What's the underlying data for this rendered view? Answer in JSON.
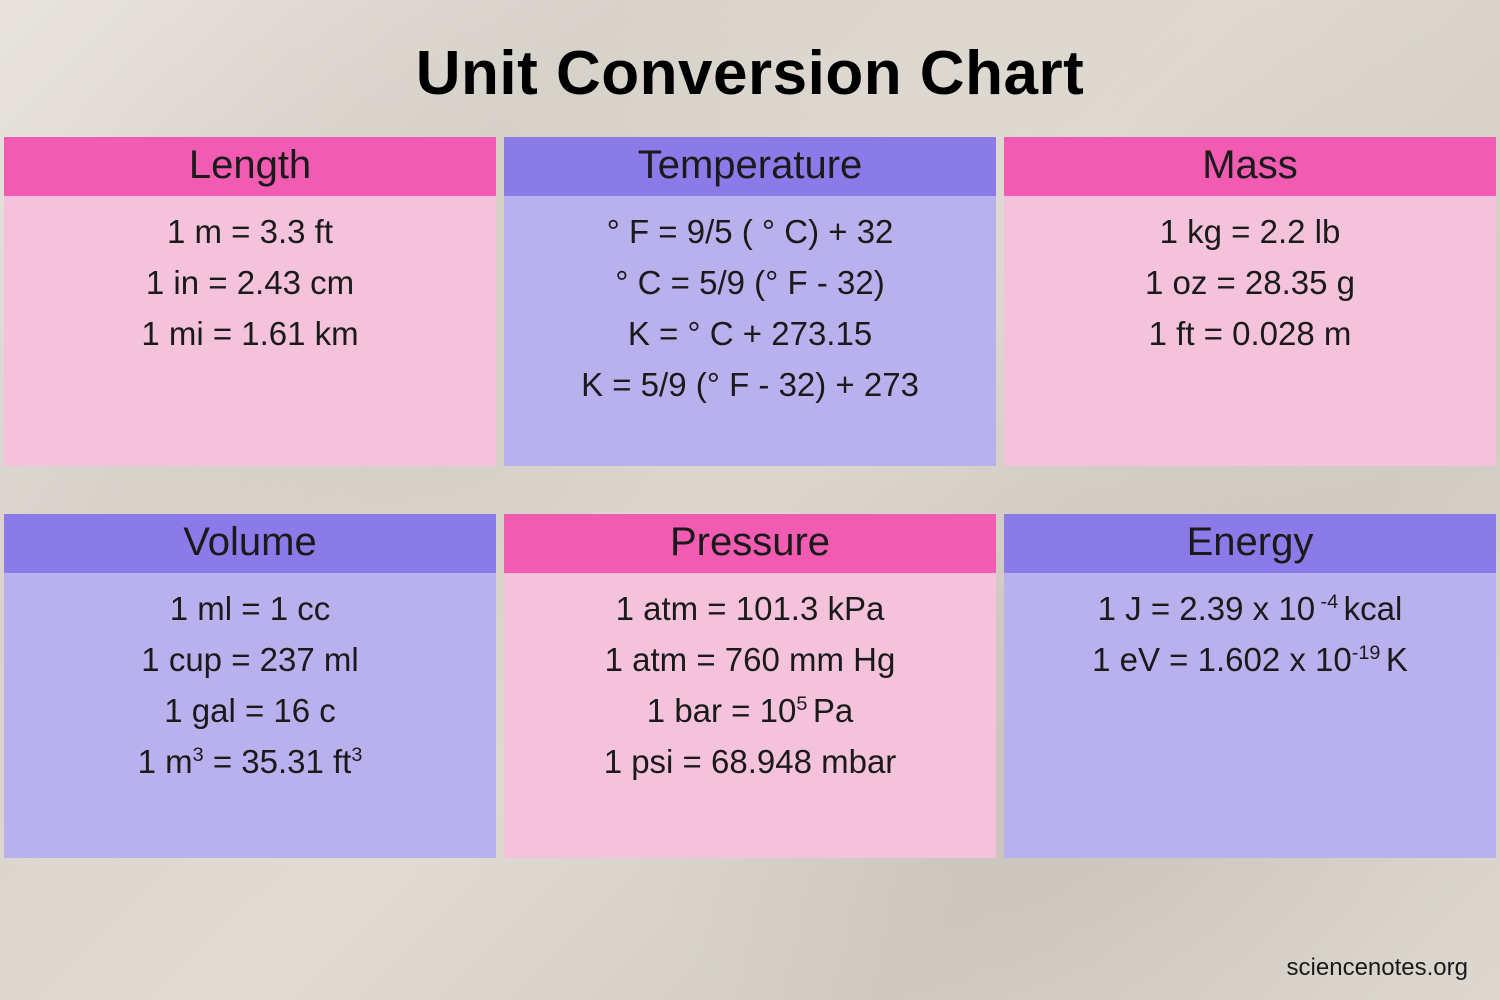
{
  "title": "Unit Conversion Chart",
  "attribution": "sciencenotes.org",
  "sections": {
    "length": {
      "header": "Length",
      "lines": [
        "1 m = 3.3 ft",
        "1 in = 2.43 cm",
        "1 mi = 1.61 km"
      ]
    },
    "temperature": {
      "header": "Temperature",
      "lines": [
        "° F = 9/5 ( ° C) + 32",
        "° C = 5/9 (° F - 32)",
        "K = ° C + 273.15",
        "K = 5/9 (° F - 32) + 273"
      ]
    },
    "mass": {
      "header": "Mass",
      "lines": [
        "1  kg = 2.2 lb",
        "1 oz = 28.35 g",
        "1 ft  = 0.028 m"
      ]
    },
    "volume": {
      "header": "Volume",
      "lines_html": [
        "1  ml = 1 cc",
        "1 cup = 237 ml",
        "1 gal = 16 c",
        "1 m<sup>3</sup>  = 35.31 ft<sup>3</sup>"
      ]
    },
    "pressure": {
      "header": "Pressure",
      "lines_html": [
        "1 atm = 101.3 kPa",
        "1 atm = 760 mm Hg",
        "1 bar = 10<sup>5 </sup>Pa",
        "1 psi = 68.948 mbar"
      ]
    },
    "energy": {
      "header": "Energy",
      "lines_html": [
        "1 J = 2.39 x 10<sup> -4 </sup>kcal",
        "1 eV = 1.602 x 10<sup>-19 </sup>K"
      ]
    }
  }
}
